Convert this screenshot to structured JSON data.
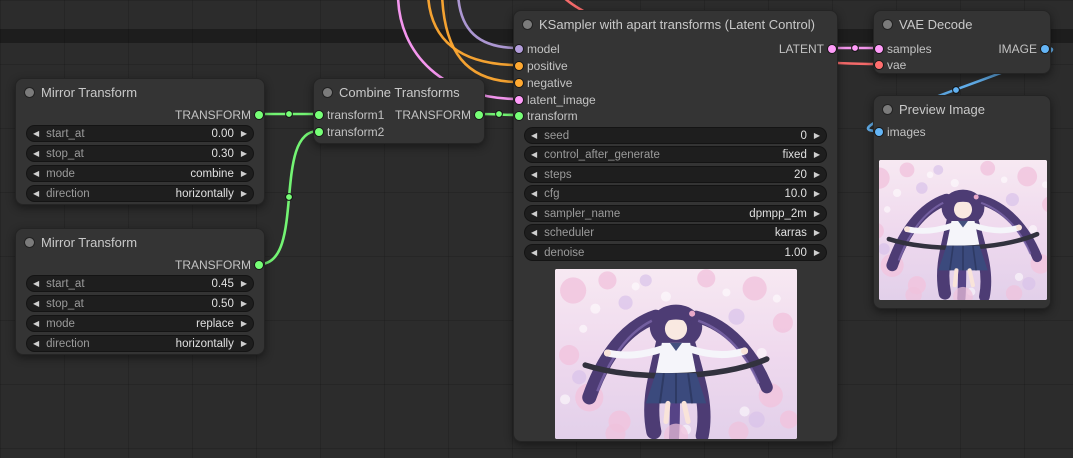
{
  "icons": {
    "arrow_left": "◀",
    "arrow_right": "▶"
  },
  "colors": {
    "transform": "#77ff77",
    "model": "#B39DDB",
    "conditioning": "#FFA931",
    "latent": "#FF9CF9",
    "vae": "#FF6E6E",
    "image": "#64B5F6"
  },
  "nodes": {
    "mirror1": {
      "title": "Mirror Transform",
      "output_label": "TRANSFORM",
      "widgets": [
        {
          "name": "start_at",
          "value": "0.00"
        },
        {
          "name": "stop_at",
          "value": "0.30"
        },
        {
          "name": "mode",
          "value": "combine"
        },
        {
          "name": "direction",
          "value": "horizontally"
        }
      ]
    },
    "mirror2": {
      "title": "Mirror Transform",
      "output_label": "TRANSFORM",
      "widgets": [
        {
          "name": "start_at",
          "value": "0.45"
        },
        {
          "name": "stop_at",
          "value": "0.50"
        },
        {
          "name": "mode",
          "value": "replace"
        },
        {
          "name": "direction",
          "value": "horizontally"
        }
      ]
    },
    "combine": {
      "title": "Combine Transforms",
      "inputs": [
        "transform1",
        "transform2"
      ],
      "output_label": "TRANSFORM"
    },
    "ksampler": {
      "title": "KSampler with apart transforms (Latent Control)",
      "inputs": [
        "model",
        "positive",
        "negative",
        "latent_image",
        "transform"
      ],
      "output_label": "LATENT",
      "widgets": [
        {
          "name": "seed",
          "value": "0"
        },
        {
          "name": "control_after_generate",
          "value": "fixed"
        },
        {
          "name": "steps",
          "value": "20"
        },
        {
          "name": "cfg",
          "value": "10.0"
        },
        {
          "name": "sampler_name",
          "value": "dpmpp_2m"
        },
        {
          "name": "scheduler",
          "value": "karras"
        },
        {
          "name": "denoise",
          "value": "1.00"
        }
      ]
    },
    "vae_decode": {
      "title": "VAE Decode",
      "inputs": [
        "samples",
        "vae"
      ],
      "output_label": "IMAGE"
    },
    "preview": {
      "title": "Preview Image",
      "inputs": [
        "images"
      ]
    }
  }
}
